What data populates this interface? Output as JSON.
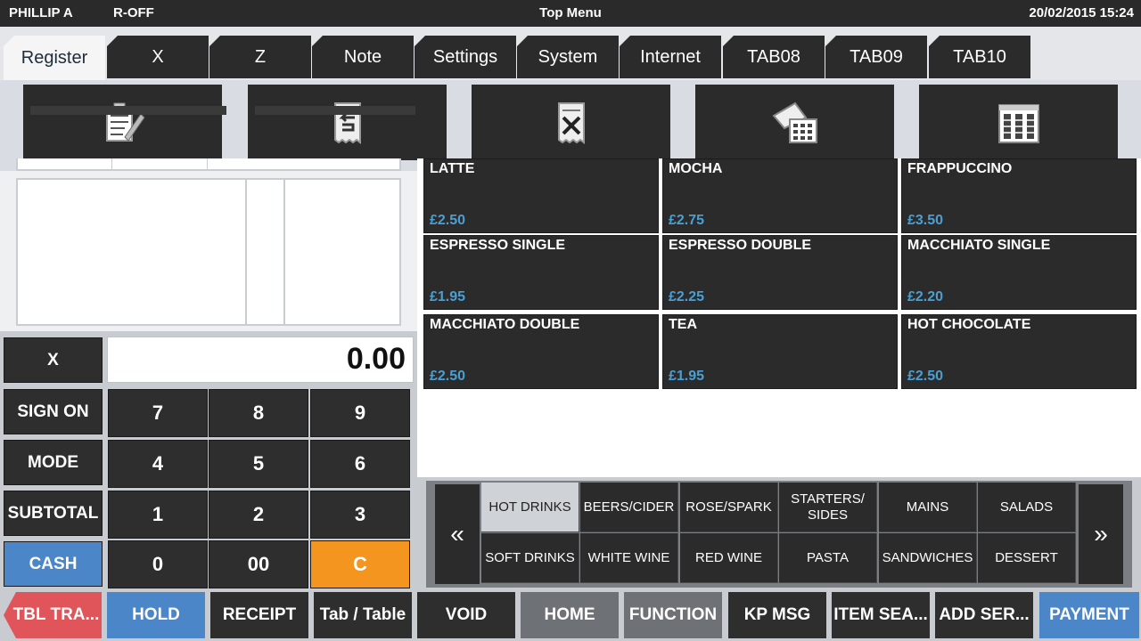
{
  "status_bar": {
    "user": "PHILLIP A",
    "mode": "R-OFF",
    "title": "Top Menu",
    "datetime": "20/02/2015 15:24"
  },
  "tabs": [
    "Register",
    "X",
    "Z",
    "Note",
    "Settings",
    "System",
    "Internet",
    "TAB08",
    "TAB09",
    "TAB10"
  ],
  "active_tab": "Register",
  "function_icons": [
    "clipboard-edit-icon",
    "receipt-return-icon",
    "receipt-void-icon",
    "table-layout-icon",
    "report-chart-icon"
  ],
  "display": {
    "amount": "0.00"
  },
  "side_keys": {
    "x": "X",
    "sign_on": "SIGN ON",
    "mode": "MODE",
    "subtotal": "SUBTOTAL",
    "cash": "CASH"
  },
  "keypad": [
    "7",
    "8",
    "9",
    "4",
    "5",
    "6",
    "1",
    "2",
    "3",
    "0",
    "00",
    "C"
  ],
  "products": [
    {
      "name": "LATTE",
      "price": "£2.50"
    },
    {
      "name": "MOCHA",
      "price": "£2.75"
    },
    {
      "name": "FRAPPUCCINO",
      "price": "£3.50"
    },
    {
      "name": "ESPRESSO SINGLE",
      "price": "£1.95"
    },
    {
      "name": "ESPRESSO DOUBLE",
      "price": "£2.25"
    },
    {
      "name": "MACCHIATO SINGLE",
      "price": "£2.20"
    },
    {
      "name": "MACCHIATO DOUBLE",
      "price": "£2.50"
    },
    {
      "name": "TEA",
      "price": "£1.95"
    },
    {
      "name": "HOT CHOCOLATE",
      "price": "£2.50"
    }
  ],
  "categories": {
    "prev_arrow": "«",
    "next_arrow": "»",
    "row1": [
      "HOT DRINKS",
      "BEERS/CIDER",
      "ROSE/SPARK",
      "STARTERS/\nSIDES",
      "MAINS",
      "SALADS"
    ],
    "row2": [
      "SOFT DRINKS",
      "WHITE WINE",
      "RED WINE",
      "PASTA",
      "SANDWICHES",
      "DESSERT"
    ],
    "active": "HOT DRINKS"
  },
  "bottom_buttons": [
    "TBL TRA...",
    "HOLD",
    "RECEIPT",
    "Tab / Table",
    "VOID",
    "HOME",
    "FUNCTION",
    "KP MSG",
    "ITEM SEA...",
    "ADD SER...",
    "PAYMENT"
  ],
  "colors": {
    "accent_blue": "#4a86c8",
    "price_blue": "#4a9fd4",
    "clear_orange": "#f3951e",
    "tbl_red": "#e0555a"
  }
}
